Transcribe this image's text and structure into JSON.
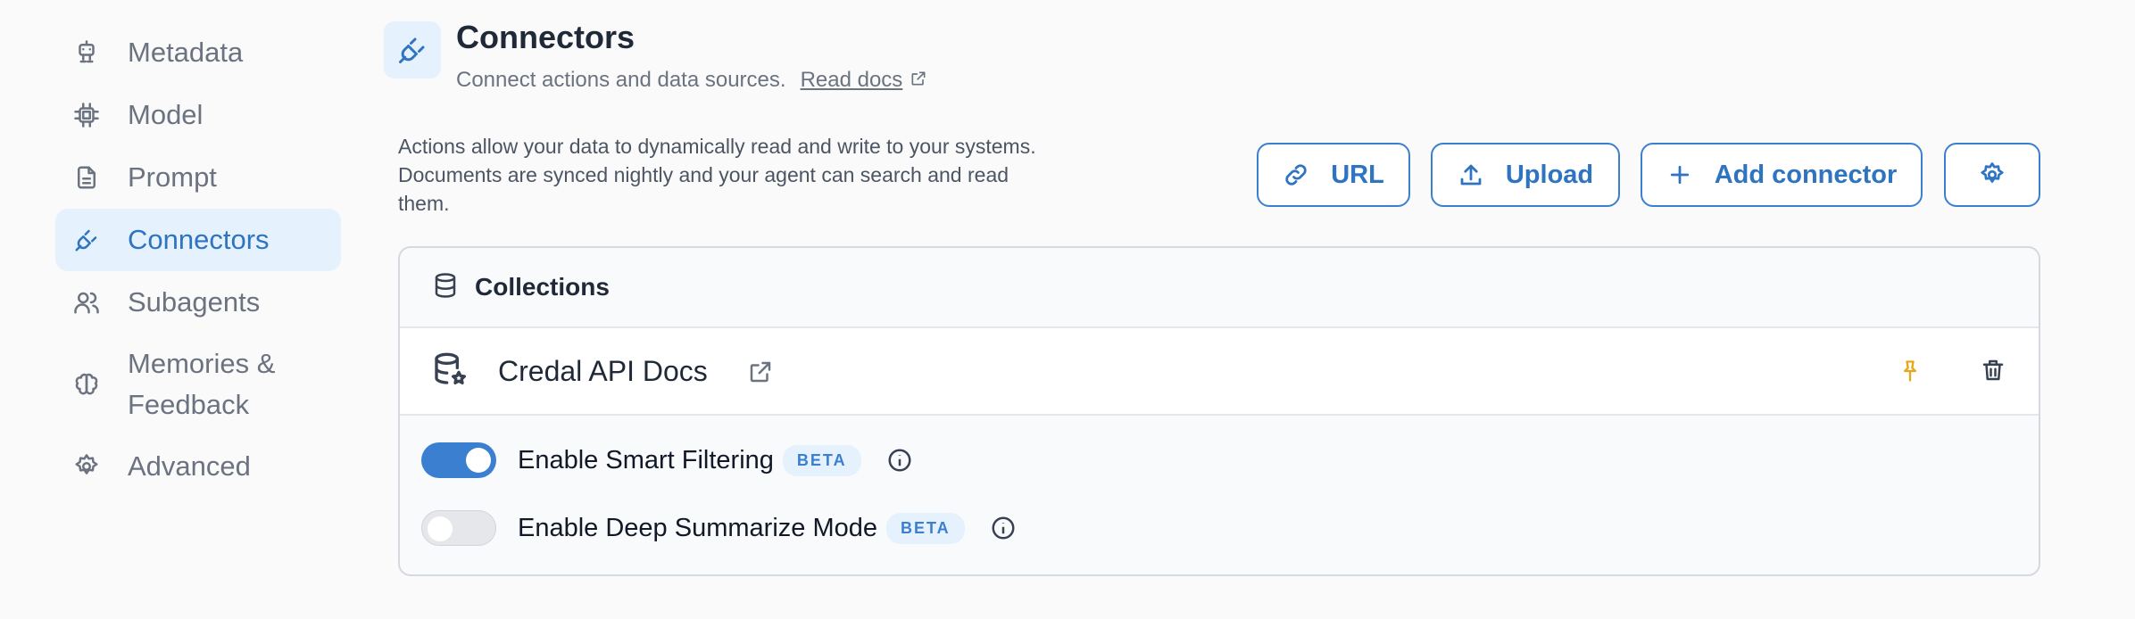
{
  "sidebar": {
    "items": [
      {
        "label": "Metadata",
        "icon": "robot-icon"
      },
      {
        "label": "Model",
        "icon": "chip-icon"
      },
      {
        "label": "Prompt",
        "icon": "document-icon"
      },
      {
        "label": "Connectors",
        "icon": "plug-icon",
        "active": true
      },
      {
        "label": "Subagents",
        "icon": "users-icon"
      },
      {
        "label": "Memories & Feedback",
        "icon": "brain-icon"
      },
      {
        "label": "Advanced",
        "icon": "gear-icon"
      }
    ]
  },
  "header": {
    "title": "Connectors",
    "subtitle": "Connect actions and data sources.",
    "read_docs": "Read docs"
  },
  "description": "Actions allow your data to dynamically read and write to your systems. Documents are synced nightly and your agent can search and read them.",
  "toolbar": {
    "url_label": "URL",
    "upload_label": "Upload",
    "add_connector_label": "Add connector"
  },
  "collections": {
    "title": "Collections",
    "items": [
      {
        "name": "Credal API Docs"
      }
    ]
  },
  "options": [
    {
      "label": "Enable Smart Filtering",
      "badge": "BETA",
      "enabled": true
    },
    {
      "label": "Enable Deep Summarize Mode",
      "badge": "BETA",
      "enabled": false
    }
  ],
  "colors": {
    "accent": "#3b7fd0",
    "active_bg": "#e5f1fc",
    "pin": "#e6a817"
  }
}
